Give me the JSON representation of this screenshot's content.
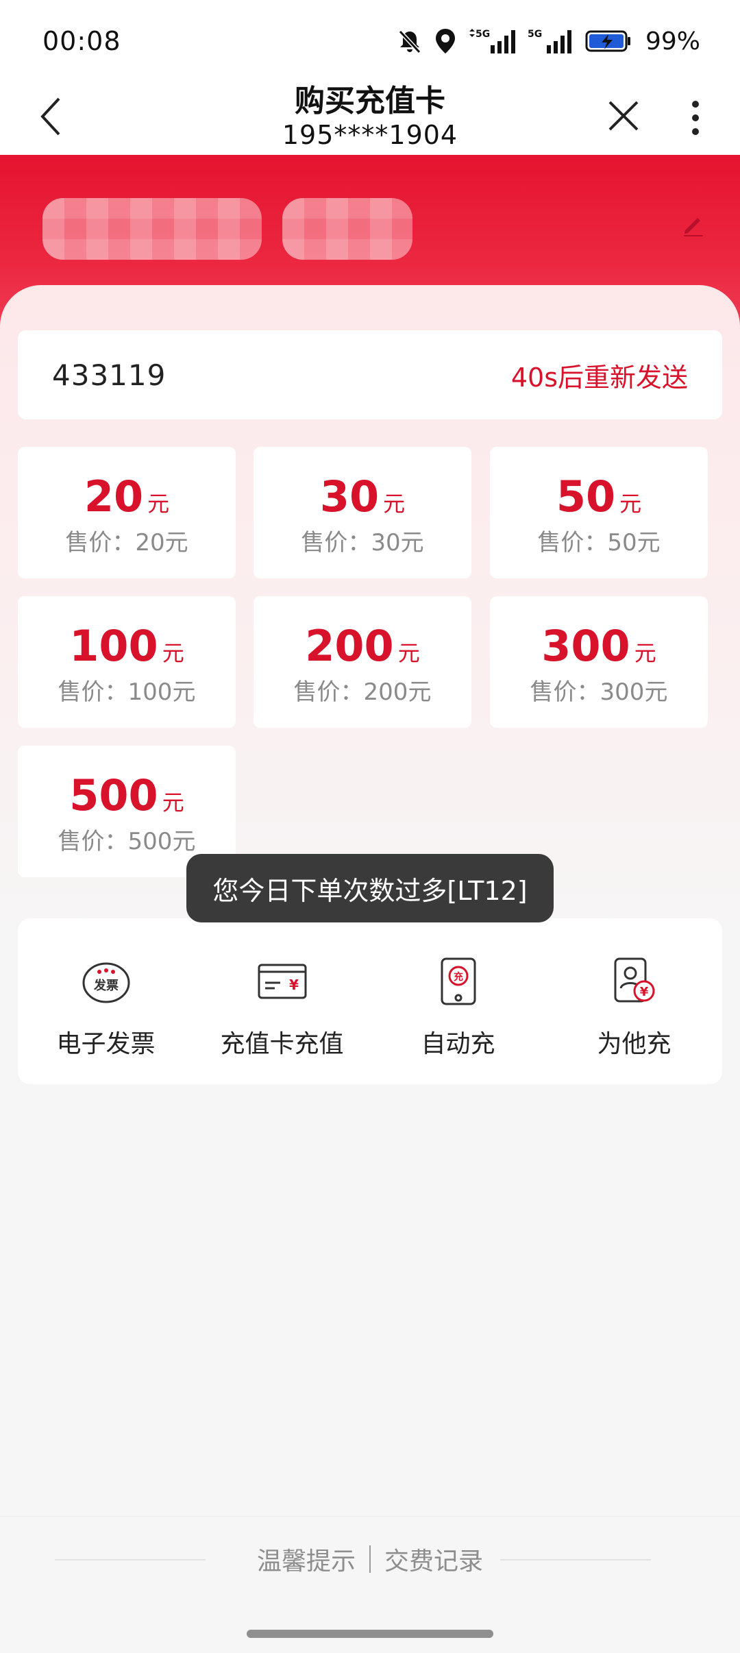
{
  "status_bar": {
    "time": "00:08",
    "battery": "99%"
  },
  "nav": {
    "title": "购买充值卡",
    "phone": "195****1904"
  },
  "verify": {
    "code": "433119",
    "resend_label": "40s后重新发送"
  },
  "cards": [
    {
      "amount": "20",
      "unit": "元",
      "price": "售价：20元"
    },
    {
      "amount": "30",
      "unit": "元",
      "price": "售价：30元"
    },
    {
      "amount": "50",
      "unit": "元",
      "price": "售价：50元"
    },
    {
      "amount": "100",
      "unit": "元",
      "price": "售价：100元"
    },
    {
      "amount": "200",
      "unit": "元",
      "price": "售价：200元"
    },
    {
      "amount": "300",
      "unit": "元",
      "price": "售价：300元"
    },
    {
      "amount": "500",
      "unit": "元",
      "price": "售价：500元"
    }
  ],
  "toast": "您今日下单次数过多[LT12]",
  "services": [
    {
      "label": "电子发票",
      "icon": "invoice-icon",
      "icon_text": "发票"
    },
    {
      "label": "充值卡充值",
      "icon": "card-recharge-icon"
    },
    {
      "label": "自动充",
      "icon": "auto-recharge-icon",
      "icon_text": "充"
    },
    {
      "label": "为他充",
      "icon": "recharge-for-others-icon"
    }
  ],
  "footer": {
    "tips": "温馨提示",
    "records": "交费记录"
  },
  "colors": {
    "brand_red": "#d8122b",
    "header_red": "#e5132f"
  }
}
